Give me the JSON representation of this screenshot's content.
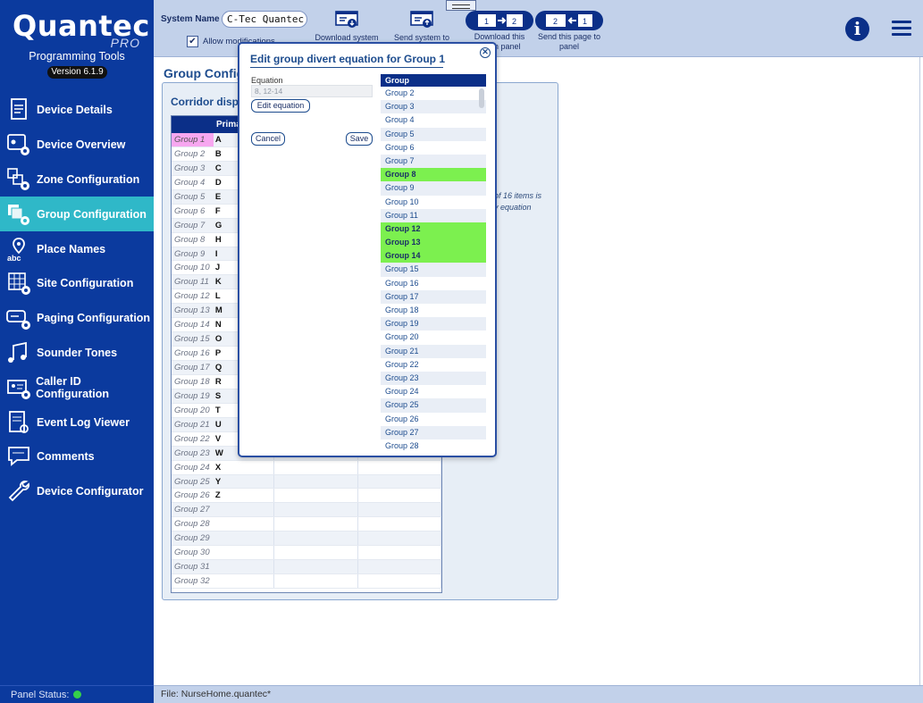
{
  "logo": {
    "brand": "Quantec",
    "pro": "PRO",
    "subtitle": "Programming Tools",
    "version": "Version 6.1.9"
  },
  "sidebar": {
    "items": [
      {
        "label": "Device Details",
        "icon": "document-icon"
      },
      {
        "label": "Device Overview",
        "icon": "device-overview-icon"
      },
      {
        "label": "Zone Configuration",
        "icon": "zone-config-icon"
      },
      {
        "label": "Group Configuration",
        "icon": "group-config-icon",
        "active": true
      },
      {
        "label": "Place Names",
        "icon": "place-names-icon"
      },
      {
        "label": "Site Configuration",
        "icon": "site-config-icon"
      },
      {
        "label": "Paging Configuration",
        "icon": "paging-config-icon"
      },
      {
        "label": "Sounder Tones",
        "icon": "music-notes-icon"
      },
      {
        "label": "Caller ID Configuration",
        "icon": "caller-id-icon"
      },
      {
        "label": "Event Log Viewer",
        "icon": "event-log-icon"
      },
      {
        "label": "Comments",
        "icon": "comments-icon"
      },
      {
        "label": "Device Configurator",
        "icon": "wrench-icon"
      }
    ],
    "panel_status_label": "Panel Status:"
  },
  "topbar": {
    "system_name_label": "System Name",
    "system_name_value": "C-Tec Quantec",
    "allow_modifications": "Allow modifications",
    "download_system": "Download system",
    "send_system": "Send system to",
    "download_page": "Download this",
    "download_page_2": "om panel",
    "send_page": "Send this page to",
    "send_page_2": "panel",
    "pill_left": "1",
    "pill_left_2": "2",
    "pill_right": "2",
    "pill_right_2": "1"
  },
  "main": {
    "title": "Group Configu",
    "card_title": "Corridor displa",
    "grid_header": "Prima",
    "note_line1": "of 16 items is",
    "note_line2": "y equation",
    "rows": [
      [
        "Group 1",
        "A"
      ],
      [
        "Group 2",
        "B"
      ],
      [
        "Group 3",
        "C"
      ],
      [
        "Group 4",
        "D"
      ],
      [
        "Group 5",
        "E"
      ],
      [
        "Group 6",
        "F"
      ],
      [
        "Group 7",
        "G"
      ],
      [
        "Group 8",
        "H"
      ],
      [
        "Group 9",
        "I"
      ],
      [
        "Group 10",
        "J"
      ],
      [
        "Group 11",
        "K"
      ],
      [
        "Group 12",
        "L"
      ],
      [
        "Group 13",
        "M"
      ],
      [
        "Group 14",
        "N"
      ],
      [
        "Group 15",
        "O"
      ],
      [
        "Group 16",
        "P"
      ],
      [
        "Group 17",
        "Q"
      ],
      [
        "Group 18",
        "R"
      ],
      [
        "Group 19",
        "S"
      ],
      [
        "Group 20",
        "T"
      ],
      [
        "Group 21",
        "U"
      ],
      [
        "Group 22",
        "V"
      ],
      [
        "Group 23",
        "W"
      ],
      [
        "Group 24",
        "X"
      ],
      [
        "Group 25",
        "Y"
      ],
      [
        "Group 26",
        "Z"
      ],
      [
        "Group 27",
        ""
      ],
      [
        "Group 28",
        ""
      ],
      [
        "Group 29",
        ""
      ],
      [
        "Group 30",
        ""
      ],
      [
        "Group 31",
        ""
      ],
      [
        "Group 32",
        ""
      ]
    ]
  },
  "file_bar": "File: NurseHome.quantec*",
  "modal": {
    "title": "Edit group divert equation for Group 1",
    "equation_label": "Equation",
    "equation_value": "8, 12-14",
    "edit_button": "Edit equation",
    "cancel_button": "Cancel",
    "save_button": "Save",
    "list_header": "Group",
    "groups": [
      {
        "label": "Group 2",
        "on": false
      },
      {
        "label": "Group 3",
        "on": false
      },
      {
        "label": "Group 4",
        "on": false
      },
      {
        "label": "Group 5",
        "on": false
      },
      {
        "label": "Group 6",
        "on": false
      },
      {
        "label": "Group 7",
        "on": false
      },
      {
        "label": "Group 8",
        "on": true
      },
      {
        "label": "Group 9",
        "on": false
      },
      {
        "label": "Group 10",
        "on": false
      },
      {
        "label": "Group 11",
        "on": false
      },
      {
        "label": "Group 12",
        "on": true
      },
      {
        "label": "Group 13",
        "on": true
      },
      {
        "label": "Group 14",
        "on": true
      },
      {
        "label": "Group 15",
        "on": false
      },
      {
        "label": "Group 16",
        "on": false
      },
      {
        "label": "Group 17",
        "on": false
      },
      {
        "label": "Group 18",
        "on": false
      },
      {
        "label": "Group 19",
        "on": false
      },
      {
        "label": "Group 20",
        "on": false
      },
      {
        "label": "Group 21",
        "on": false
      },
      {
        "label": "Group 22",
        "on": false
      },
      {
        "label": "Group 23",
        "on": false
      },
      {
        "label": "Group 24",
        "on": false
      },
      {
        "label": "Group 25",
        "on": false
      },
      {
        "label": "Group 26",
        "on": false
      },
      {
        "label": "Group 27",
        "on": false
      },
      {
        "label": "Group 28",
        "on": false
      }
    ]
  },
  "colors": {
    "sidebar": "#0b3a9e",
    "active": "#2fb8c8",
    "highlight": "#7cf04f",
    "selected_row": "#f7a7f0"
  }
}
